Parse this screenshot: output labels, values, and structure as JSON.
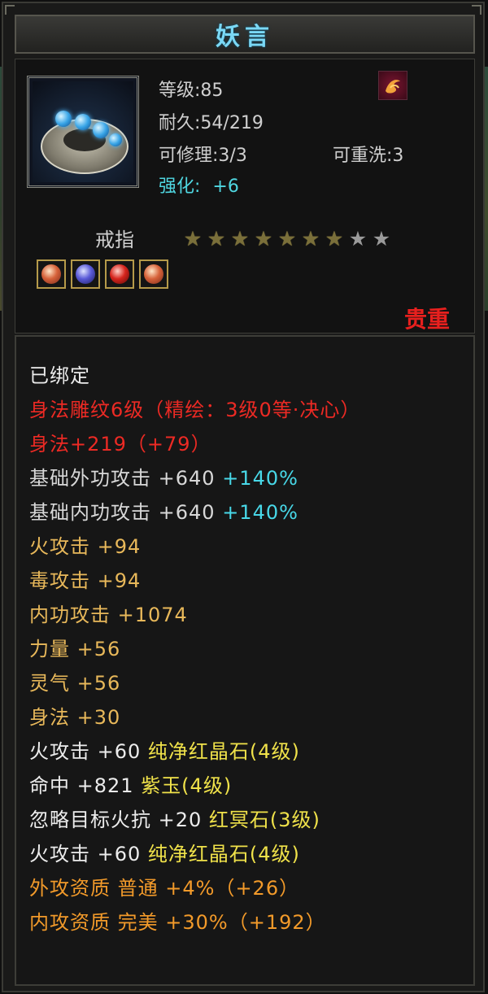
{
  "item": {
    "name": "妖言",
    "level": "等级:85",
    "durability": "耐久:54/219",
    "repairable": "可修理:3/3",
    "rewashable": "可重洗:3",
    "enhance_label": "强化:",
    "enhance_value": "+6",
    "type": "戒指",
    "rarity": "贵重",
    "stars_filled": 7,
    "stars_total": 9,
    "gem_slots": [
      "gold-gem",
      "blue-gem",
      "red-gem",
      "gold-gem"
    ]
  },
  "attributes": [
    {
      "segments": [
        {
          "text": "已绑定",
          "color": "white"
        }
      ]
    },
    {
      "segments": [
        {
          "text": "身法雕纹6级（精绘：3级0等·决心）",
          "color": "red"
        }
      ]
    },
    {
      "segments": [
        {
          "text": "身法+219（+79）",
          "color": "red"
        }
      ]
    },
    {
      "segments": [
        {
          "text": "基础外功攻击 +640 ",
          "color": "light"
        },
        {
          "text": "+140%",
          "color": "cyan"
        }
      ]
    },
    {
      "segments": [
        {
          "text": "基础内功攻击 +640 ",
          "color": "light"
        },
        {
          "text": "+140%",
          "color": "cyan"
        }
      ]
    },
    {
      "segments": [
        {
          "text": "火攻击 +94",
          "color": "gold"
        }
      ]
    },
    {
      "segments": [
        {
          "text": "毒攻击 +94",
          "color": "gold"
        }
      ]
    },
    {
      "segments": [
        {
          "text": "内功攻击 +1074",
          "color": "gold"
        }
      ]
    },
    {
      "segments": [
        {
          "text": "力量 +56",
          "color": "gold"
        }
      ]
    },
    {
      "segments": [
        {
          "text": "灵气 +56",
          "color": "gold"
        }
      ]
    },
    {
      "segments": [
        {
          "text": "身法 +30",
          "color": "gold"
        }
      ]
    },
    {
      "segments": [
        {
          "text": "火攻击 +60 ",
          "color": "white"
        },
        {
          "text": "纯净红晶石(4级)",
          "color": "yellow"
        }
      ]
    },
    {
      "segments": [
        {
          "text": "命中 +821 ",
          "color": "white"
        },
        {
          "text": "紫玉(4级)",
          "color": "yellow"
        }
      ]
    },
    {
      "segments": [
        {
          "text": "忽略目标火抗 +20 ",
          "color": "white"
        },
        {
          "text": "红冥石(3级)",
          "color": "yellow"
        }
      ]
    },
    {
      "segments": [
        {
          "text": "火攻击 +60 ",
          "color": "white"
        },
        {
          "text": "纯净红晶石(4级)",
          "color": "yellow"
        }
      ]
    },
    {
      "segments": [
        {
          "text": "外攻资质  普通 +4%（+26）",
          "color": "orange"
        }
      ]
    },
    {
      "segments": [
        {
          "text": "内攻资质  完美 +30%（+192）",
          "color": "orange"
        }
      ]
    }
  ],
  "colors": {
    "white": "#ececec",
    "light": "#d8d8d8",
    "red": "#ec2a24",
    "gold": "#e8b85a",
    "orange": "#f29a2a",
    "cyan": "#48d8e8",
    "yellow": "#f0e24a",
    "rarity": "#e8201e",
    "title": "#7ad8f5"
  }
}
